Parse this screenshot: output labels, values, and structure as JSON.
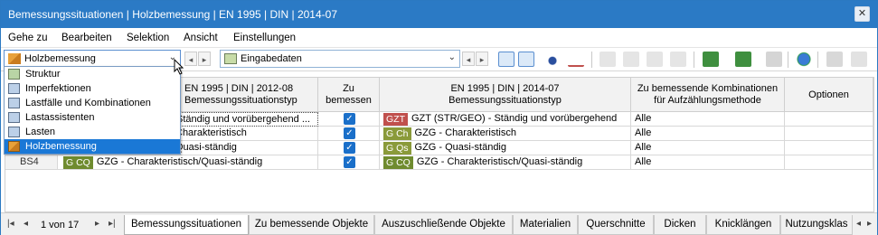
{
  "window": {
    "title": "Bemessungssituationen | Holzbemessung | EN 1995 | DIN | 2014-07",
    "close_glyph": "✕"
  },
  "menu": [
    "Gehe zu",
    "Bearbeiten",
    "Selektion",
    "Ansicht",
    "Einstellungen"
  ],
  "toolbar": {
    "module_combo": {
      "value": "Holzbemessung",
      "icon": "timber-icon"
    },
    "input_combo": {
      "value": "Eingabedaten",
      "icon": "table-input-icon"
    }
  },
  "dropdown": {
    "items": [
      "Struktur",
      "Imperfektionen",
      "Lastfälle und Kombinationen",
      "Lastassistenten",
      "Lasten",
      "Holzbemessung"
    ],
    "selected": "Holzbemessung"
  },
  "table": {
    "headers": {
      "col1": [
        "EN 1995 | DIN | 2012-08",
        "Bemessungssituationstyp"
      ],
      "col2": [
        "Zu",
        "bemessen"
      ],
      "col3": [
        "EN 1995 | DIN | 2014-07",
        "Bemessungssituationstyp"
      ],
      "col4": [
        "Zu bemessende Kombinationen",
        "für Aufzählungsmethode"
      ],
      "col5": [
        "Optionen"
      ]
    },
    "rows": [
      {
        "id": "BS1",
        "left_text": "Ständig und vorübergehend ...",
        "checked": true,
        "badge": "GZT",
        "badge_color": "#c0504d",
        "type": "GZT (STR/GEO) - Ständig und vorübergehend",
        "combos": "Alle"
      },
      {
        "id": "BS2",
        "left_text": "Charakteristisch",
        "checked": true,
        "badge": "G Ch",
        "badge_color": "#8a9a3a",
        "type": "GZG - Charakteristisch",
        "combos": "Alle"
      },
      {
        "id": "BS3",
        "left_text": "Quasi-ständig",
        "checked": true,
        "badge": "G Qs",
        "badge_color": "#8a9a3a",
        "type": "GZG - Quasi-ständig",
        "combos": "Alle"
      },
      {
        "id": "BS4",
        "left_badge": "G CQ",
        "left_text": "GZG - Charakteristisch/Quasi-ständig",
        "checked": true,
        "badge": "G CQ",
        "badge_color": "#6f8b2f",
        "type": "GZG - Charakteristisch/Quasi-ständig",
        "combos": "Alle"
      }
    ]
  },
  "pager": {
    "label": "1 von 17"
  },
  "tabs": [
    "Bemessungssituationen",
    "Zu bemessende Objekte",
    "Auszuschließende Objekte",
    "Materialien",
    "Querschnitte",
    "Dicken",
    "Knicklängen",
    "Nutzungsklas"
  ],
  "active_tab": "Bemessungssituationen"
}
